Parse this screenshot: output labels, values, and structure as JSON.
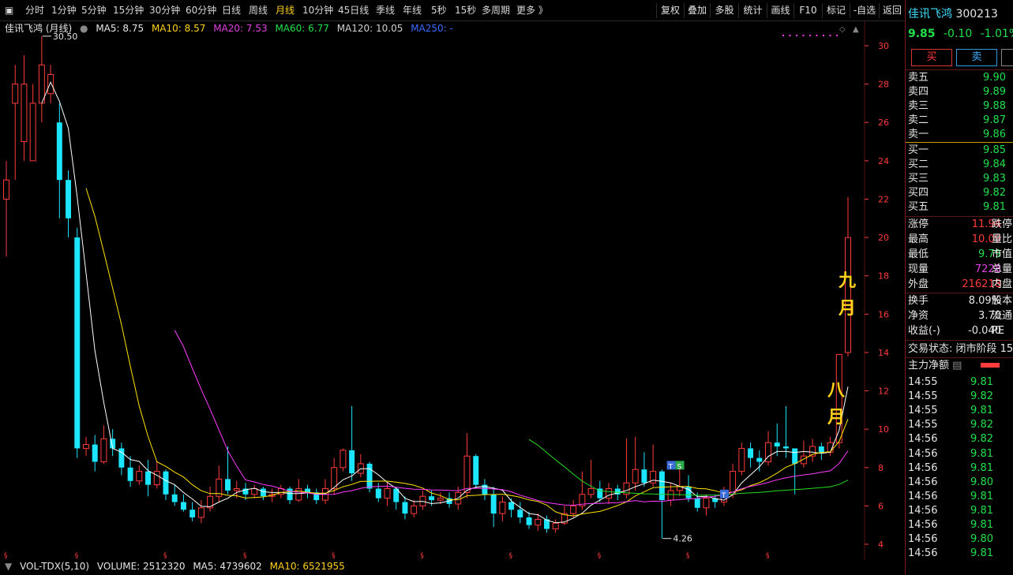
{
  "toolbar": {
    "periods": [
      "分时",
      "1分钟",
      "5分钟",
      "15分钟",
      "30分钟",
      "60分钟",
      "日线",
      "周线",
      "月线",
      "10分钟",
      "45日线",
      "季线",
      "年线",
      "5秒",
      "15秒",
      "多周期",
      "更多 》"
    ],
    "active_period": "月线",
    "buttons": [
      "复权",
      "叠加",
      "多股",
      "统计",
      "画线",
      "F10",
      "标记",
      "-自选",
      "返回"
    ]
  },
  "legend": {
    "title": "佳讯飞鸿 (月线)",
    "ma5": "MA5: 8.75",
    "ma10": "MA10: 8.57",
    "ma20": "MA20: 7.53",
    "ma60": "MA60: 6.77",
    "ma120": "MA120: 10.05",
    "ma250": "MA250: -"
  },
  "volume_legend": {
    "title": "VOL-TDX(5,10)",
    "volume": "VOLUME: 2512320",
    "ma5": "MA5: 4739602",
    "ma10": "MA10: 6521955"
  },
  "annotations": {
    "high_label": "30.50",
    "low_label": "4.26",
    "jiu": "九",
    "yue1": "月",
    "ba": "八",
    "yue2": "月",
    "buy_marker": "S",
    "t_marker": "T"
  },
  "panel": {
    "name": "佳讯飞鸿",
    "code": "300213",
    "price": "9.85",
    "change": "-0.10",
    "change_pct": "-1.01%",
    "buy_button": "买",
    "sell_button": "卖",
    "asks": [
      {
        "label": "卖五",
        "price": "9.90"
      },
      {
        "label": "卖四",
        "price": "9.89"
      },
      {
        "label": "卖三",
        "price": "9.88"
      },
      {
        "label": "卖二",
        "price": "9.87"
      },
      {
        "label": "卖一",
        "price": "9.86"
      }
    ],
    "bids": [
      {
        "label": "买一",
        "price": "9.85"
      },
      {
        "label": "买二",
        "price": "9.84"
      },
      {
        "label": "买三",
        "price": "9.83"
      },
      {
        "label": "买四",
        "price": "9.82"
      },
      {
        "label": "买五",
        "price": "9.81"
      }
    ],
    "stats": [
      {
        "label": "涨停",
        "value": "11.94",
        "tail": "跌停"
      },
      {
        "label": "最高",
        "value": "10.09",
        "tail": "量比"
      },
      {
        "label": "最低",
        "value": "9.79",
        "tail": "市值"
      },
      {
        "label": "现量",
        "value": "7228",
        "tail": "总量"
      },
      {
        "label": "外盘",
        "value": "216218",
        "tail": "内盘"
      }
    ],
    "stats2": [
      {
        "label": "换手",
        "value": "8.09%",
        "tail": "股本"
      },
      {
        "label": "净资",
        "value": "3.70",
        "tail": "流通"
      },
      {
        "label": "收益(-)",
        "value": "-0.040",
        "tail": "PE"
      }
    ],
    "trade_status": "交易状态: 闭市阶段 15",
    "main_flow": "主力净额",
    "ticks": [
      {
        "time": "14:55",
        "price": "9.81"
      },
      {
        "time": "14:55",
        "price": "9.82"
      },
      {
        "time": "14:55",
        "price": "9.81"
      },
      {
        "time": "14:55",
        "price": "9.82"
      },
      {
        "time": "14:56",
        "price": "9.82"
      },
      {
        "time": "14:56",
        "price": "9.81"
      },
      {
        "time": "14:56",
        "price": "9.81"
      },
      {
        "time": "14:56",
        "price": "9.80"
      },
      {
        "time": "14:56",
        "price": "9.81"
      },
      {
        "time": "14:56",
        "price": "9.81"
      },
      {
        "time": "14:56",
        "price": "9.81"
      },
      {
        "time": "14:56",
        "price": "9.80"
      },
      {
        "time": "14:56",
        "price": "9.81"
      }
    ]
  },
  "colors": {
    "up": "#ff3b3b",
    "down": "#1ce6ff",
    "ma5": "#ffffff",
    "ma10": "#ffe400",
    "ma20": "#ff3cff",
    "ma60": "#22dd22",
    "ma120": "#cfcfcf",
    "axis": "#ff3b3b"
  },
  "chart_data": {
    "type": "candlestick",
    "period": "monthly",
    "ylim": [
      3.5,
      31.5
    ],
    "y_ticks": [
      4,
      6,
      8,
      10,
      12,
      14,
      16,
      18,
      20,
      22,
      24,
      26,
      28,
      30
    ],
    "candles": [
      [
        22,
        23,
        19,
        24
      ],
      [
        27,
        28,
        23,
        29
      ],
      [
        25,
        28,
        24,
        29.5
      ],
      [
        24,
        27,
        25,
        28
      ],
      [
        27,
        29,
        26,
        30.5
      ],
      [
        27.5,
        28.5,
        27,
        29
      ],
      [
        26,
        23,
        21,
        27
      ],
      [
        23,
        21,
        20,
        23.5
      ],
      [
        20,
        9,
        8.5,
        20.5
      ],
      [
        9,
        9.2,
        8.6,
        9.6
      ],
      [
        9.2,
        8.3,
        7.8,
        9.7
      ],
      [
        8.3,
        9.5,
        8.2,
        10.2
      ],
      [
        9.5,
        9.0,
        8.6,
        10.0
      ],
      [
        9,
        8.0,
        7.6,
        9.3
      ],
      [
        8,
        7.3,
        7.0,
        8.6
      ],
      [
        7.3,
        7.8,
        7.1,
        8.1
      ],
      [
        7.8,
        7.1,
        6.5,
        8.4
      ],
      [
        7.1,
        7.8,
        6.9,
        8.3
      ],
      [
        7.8,
        6.6,
        6.3,
        7.9
      ],
      [
        6.6,
        6.2,
        6.0,
        7.1
      ],
      [
        6.2,
        5.8,
        5.7,
        6.6
      ],
      [
        5.8,
        5.4,
        5.2,
        6.2
      ],
      [
        5.4,
        5.9,
        5.1,
        6.3
      ],
      [
        5.9,
        6.5,
        5.7,
        7.0
      ],
      [
        6.5,
        7.4,
        6.2,
        8.1
      ],
      [
        7.4,
        6.8,
        6.6,
        9.1
      ],
      [
        6.8,
        6.9,
        6.4,
        7.3
      ],
      [
        6.9,
        6.6,
        6.3,
        7.2
      ],
      [
        6.6,
        6.9,
        6.4,
        7.1
      ],
      [
        6.9,
        6.5,
        6.3,
        7.0
      ],
      [
        6.5,
        6.6,
        6.2,
        6.9
      ],
      [
        6.6,
        6.9,
        6.4,
        7.1
      ],
      [
        6.9,
        6.3,
        6.1,
        7.0
      ],
      [
        6.3,
        6.9,
        6.2,
        7.4
      ],
      [
        6.9,
        6.7,
        6.4,
        7.1
      ],
      [
        6.7,
        6.3,
        6.1,
        6.9
      ],
      [
        6.3,
        6.9,
        6.1,
        7.4
      ],
      [
        6.9,
        8.0,
        6.6,
        8.5
      ],
      [
        8.0,
        8.9,
        7.8,
        9.0
      ],
      [
        8.9,
        7.7,
        7.3,
        11.2
      ],
      [
        7.7,
        8.2,
        7.5,
        8.7
      ],
      [
        8.2,
        6.9,
        6.7,
        8.3
      ],
      [
        6.9,
        6.4,
        6.2,
        7.2
      ],
      [
        6.4,
        6.9,
        6.0,
        7.2
      ],
      [
        6.9,
        6.2,
        5.8,
        7.0
      ],
      [
        6.2,
        5.6,
        5.3,
        6.5
      ],
      [
        5.6,
        6.0,
        5.4,
        6.3
      ],
      [
        6.0,
        6.5,
        5.8,
        6.8
      ],
      [
        6.5,
        6.3,
        6.0,
        6.8
      ],
      [
        6.3,
        6.4,
        6.1,
        6.7
      ],
      [
        6.4,
        6.1,
        5.9,
        6.7
      ],
      [
        6.1,
        6.7,
        5.8,
        7.0
      ],
      [
        6.7,
        8.6,
        6.4,
        9.8
      ],
      [
        8.6,
        7.1,
        6.9,
        8.7
      ],
      [
        7.1,
        6.6,
        6.3,
        7.4
      ],
      [
        6.6,
        5.6,
        4.9,
        7.0
      ],
      [
        5.6,
        6.2,
        5.2,
        6.5
      ],
      [
        6.2,
        5.8,
        5.4,
        6.4
      ],
      [
        5.8,
        5.4,
        5.1,
        6.2
      ],
      [
        5.4,
        5.0,
        4.8,
        5.7
      ],
      [
        5.0,
        5.3,
        4.7,
        5.6
      ],
      [
        5.3,
        4.8,
        4.6,
        5.5
      ],
      [
        4.8,
        5.1,
        4.6,
        5.3
      ],
      [
        5.1,
        5.6,
        5.0,
        6.0
      ],
      [
        5.6,
        6.0,
        5.4,
        6.3
      ],
      [
        6.0,
        6.6,
        5.8,
        7.8
      ],
      [
        6.6,
        6.9,
        6.4,
        8.4
      ],
      [
        6.9,
        6.4,
        6.2,
        7.3
      ],
      [
        6.4,
        6.9,
        6.1,
        7.2
      ],
      [
        6.9,
        6.6,
        6.3,
        7.1
      ],
      [
        6.6,
        7.2,
        6.4,
        9.5
      ],
      [
        7.2,
        7.9,
        6.8,
        9.6
      ],
      [
        7.9,
        7.2,
        7.0,
        8.8
      ],
      [
        7.2,
        7.8,
        7.0,
        9.2
      ],
      [
        7.8,
        6.3,
        4.3,
        7.9
      ],
      [
        6.3,
        6.8,
        6.0,
        7.2
      ],
      [
        6.8,
        7.0,
        6.5,
        8.0
      ],
      [
        7.0,
        6.4,
        6.2,
        7.6
      ],
      [
        6.4,
        5.9,
        5.7,
        6.7
      ],
      [
        5.9,
        6.4,
        5.5,
        6.6
      ],
      [
        6.4,
        6.2,
        5.9,
        6.6
      ],
      [
        6.2,
        6.6,
        6.0,
        7.0
      ],
      [
        6.6,
        7.8,
        6.4,
        8.2
      ],
      [
        7.8,
        9.0,
        7.6,
        9.3
      ],
      [
        9.0,
        8.5,
        8.0,
        9.3
      ],
      [
        8.5,
        8.3,
        7.8,
        8.9
      ],
      [
        8.3,
        9.3,
        8.1,
        9.9
      ],
      [
        9.3,
        9.1,
        8.6,
        10.3
      ],
      [
        9.1,
        9.0,
        8.5,
        11.2
      ],
      [
        9.0,
        8.2,
        6.6,
        9.0
      ],
      [
        8.2,
        8.6,
        8.0,
        9.4
      ],
      [
        8.6,
        9.1,
        8.3,
        9.5
      ],
      [
        9.1,
        8.8,
        8.4,
        9.3
      ],
      [
        8.8,
        9.3,
        8.6,
        9.6
      ],
      [
        9.3,
        13.9,
        9.0,
        13.9
      ],
      [
        14.0,
        20.0,
        13.8,
        22.1
      ]
    ]
  }
}
